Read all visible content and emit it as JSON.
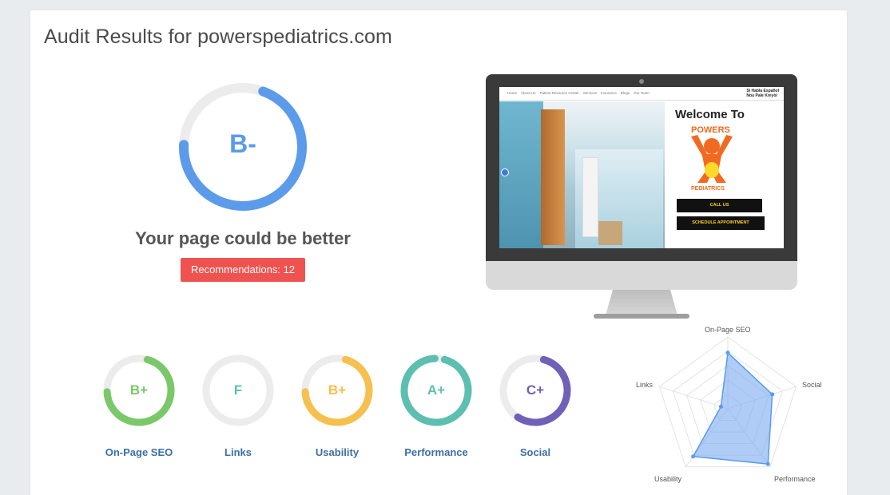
{
  "header": {
    "title": "Audit Results for powerspediatrics.com"
  },
  "overall": {
    "grade": "B-",
    "score_fraction": 0.7,
    "ring_color": "#5b9bea",
    "track_color": "#ececec",
    "headline": "Your page could be better",
    "recommendations_label": "Recommendations: 12",
    "button_color": "#ef5350"
  },
  "preview": {
    "nav_links": [
      "Home",
      "About Us",
      "Patient Resource Center",
      "Services",
      "Insurance",
      "Blogs",
      "Our Team"
    ],
    "lang_line1": "Si Habla Español",
    "lang_line2": "Nou Pale Kreyòl",
    "welcome": "Welcome To",
    "logo_top": "POWERS",
    "logo_bottom": "PEDIATRICS",
    "call_button": "CALL US",
    "appt_button": "SCHEDULE APPOINTMENT",
    "button_text_color": "#ffcf1a",
    "logo_color": "#f26a21"
  },
  "categories": [
    {
      "label": "On-Page SEO",
      "grade": "B+",
      "fraction": 0.7,
      "color": "#7ac86a"
    },
    {
      "label": "Links",
      "grade": "F",
      "fraction": 0.0,
      "color": "#5cbfb0"
    },
    {
      "label": "Usability",
      "grade": "B+",
      "fraction": 0.7,
      "color": "#f6c04e"
    },
    {
      "label": "Performance",
      "grade": "A+",
      "fraction": 0.95,
      "color": "#5cbfb0"
    },
    {
      "label": "Social",
      "grade": "C+",
      "fraction": 0.55,
      "color": "#7160b8"
    }
  ],
  "radar": {
    "axes": [
      "On-Page SEO",
      "Social",
      "Performance",
      "Usability",
      "Links"
    ],
    "values": [
      0.78,
      0.65,
      0.95,
      0.82,
      0.1
    ],
    "max": 1,
    "rings": 5,
    "fill_color": "#7aaaf0",
    "stroke_color": "#5b9bea"
  }
}
